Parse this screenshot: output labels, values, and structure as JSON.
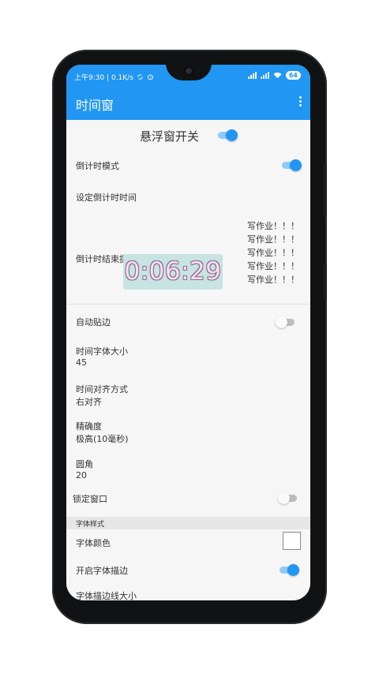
{
  "status_bar": {
    "time_and_speed": "上午9:30 | 0.1K/s",
    "battery": "64"
  },
  "toolbar": {
    "title": "时间窗"
  },
  "settings": {
    "float_window_switch_label": "悬浮窗开关",
    "float_window_switch": true,
    "countdown_mode_label": "倒计时模式",
    "countdown_mode": true,
    "set_countdown_time_label": "设定倒计时时间",
    "countdown_end_tip_label": "倒计时结束提示",
    "countdown_end_tip_lines": [
      "写作业！！！",
      "写作业！！！",
      "写作业！！！",
      "写作业！！！",
      "写作业！！！"
    ],
    "auto_snap_label": "自动贴边",
    "auto_snap": false,
    "font_size_label": "时间字体大小",
    "font_size_value": "45",
    "align_label": "时间对齐方式",
    "align_value": "右对齐",
    "precision_label": "精确度",
    "precision_value": "极高(10毫秒)",
    "radius_label": "圆角",
    "radius_value": "20",
    "lock_window_label": "锁定窗口",
    "lock_window": false
  },
  "font_style_section": {
    "header": "字体样式",
    "font_color_label": "字体颜色",
    "font_color": "#ffffff",
    "enable_stroke_label": "开启字体描边",
    "enable_stroke": true,
    "stroke_width_label": "字体描边线大小"
  },
  "floating_timer": {
    "time": "0:06:29"
  },
  "colors": {
    "accent": "#2196f3",
    "timer_background": "#c7e3e2"
  }
}
